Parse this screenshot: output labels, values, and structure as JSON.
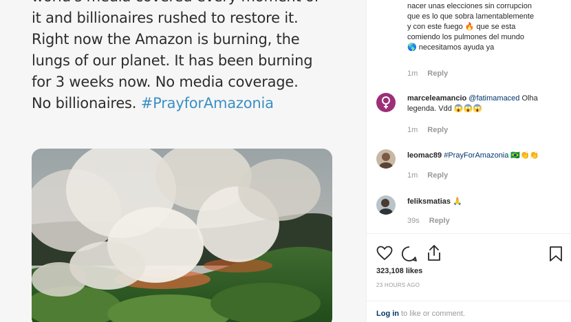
{
  "post": {
    "tweet_lines": [
      "world's media covered every moment of",
      "it and billionaires rushed to restore it.",
      "Right now the Amazon is burning, the",
      "lungs of our planet. It has been burning",
      "for 3 weeks now. No media coverage.",
      "No billionaires. "
    ],
    "hashtag": "#PrayforAmazonia",
    "photo_icon": "forest-fire-photo"
  },
  "comments": [
    {
      "username": "",
      "lines": [
        "nacer unas elecciones sin corrupcion",
        "que es lo que sobra lamentablemente",
        "y con este fuego 🔥 que se esta",
        "comiendo los pulmones del mundo",
        "🌎 necesitamos ayuda ya"
      ],
      "time": "1m",
      "reply": "Reply"
    },
    {
      "username": "marceleamancio",
      "mention": "@fatimamaced",
      "text_after": " Olha",
      "line2": "legenda. Vdd 😱😱😱",
      "time": "1m",
      "reply": "Reply"
    },
    {
      "username": "leomac89",
      "hashtag": "#PrayForAmazonia",
      "suffix": " 🇧🇷👏👏",
      "time": "1m",
      "reply": "Reply"
    },
    {
      "username": "feliksmatias",
      "suffix": " 🙏",
      "time": "39s",
      "reply": "Reply"
    }
  ],
  "actions": {
    "like_icon": "heart-icon",
    "comment_icon": "comment-icon",
    "share_icon": "share-icon",
    "save_icon": "bookmark-icon"
  },
  "likes": "323,108 likes",
  "timestamp": "23 HOURS AGO",
  "login": {
    "link": "Log in",
    "rest": " to like or comment."
  },
  "colors": {
    "link": "#003569",
    "muted": "#999999",
    "hashtag_tweet": "#3b8fc4"
  }
}
